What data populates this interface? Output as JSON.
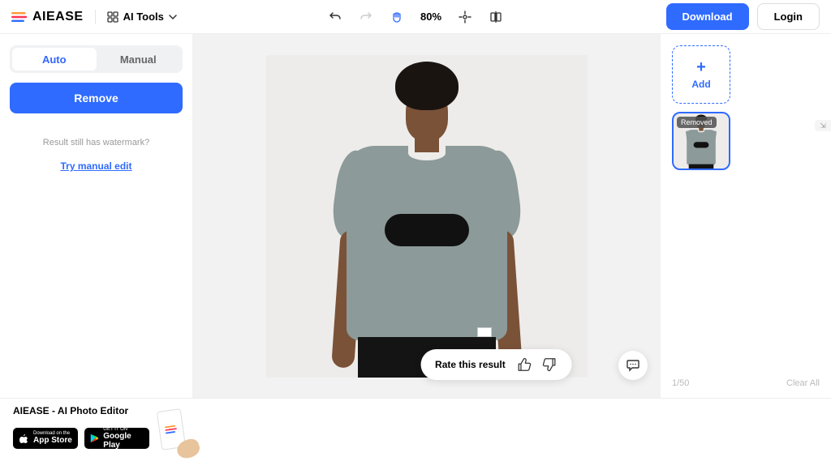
{
  "brand": "AIEASE",
  "header": {
    "ai_tools": "AI Tools",
    "zoom": "80%",
    "download": "Download",
    "login": "Login"
  },
  "sidebar": {
    "tabs": {
      "auto": "Auto",
      "manual": "Manual"
    },
    "remove": "Remove",
    "watermark_q": "Result still has watermark?",
    "manual_link": "Try manual edit"
  },
  "canvas": {
    "rate_label": "Rate this result"
  },
  "right": {
    "add": "Add",
    "badge": "Removed",
    "counter": "1/50",
    "clear": "Clear All"
  },
  "footer": {
    "title": "AIEASE - AI Photo Editor",
    "appstore_small": "Download on the",
    "appstore_big": "App Store",
    "play_small": "GET IT ON",
    "play_big": "Google Play"
  }
}
